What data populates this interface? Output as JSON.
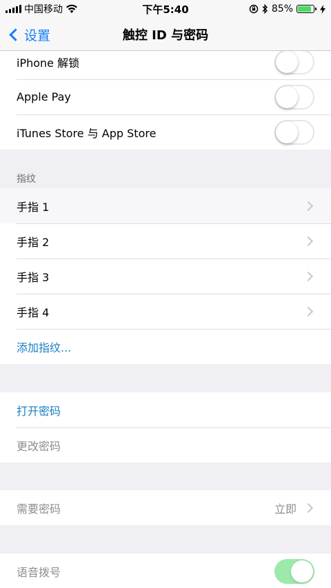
{
  "status": {
    "carrier": "中国移动",
    "time": "下午5:40",
    "battery_percent": "85%",
    "battery_level": 0.85,
    "icons": [
      "signal-icon",
      "wifi-icon",
      "orientation-lock-icon",
      "bluetooth-icon",
      "battery-icon",
      "charging-icon"
    ]
  },
  "nav": {
    "back_label": "设置",
    "title": "触控 ID 与密码"
  },
  "unlock_group": {
    "items": [
      {
        "label": "iPhone 解锁",
        "on": false
      },
      {
        "label": "Apple Pay",
        "on": false
      },
      {
        "label": "iTunes Store 与 App Store",
        "on": false
      }
    ]
  },
  "fingerprints": {
    "header": "指纹",
    "items": [
      "手指 1",
      "手指 2",
      "手指 3",
      "手指 4"
    ],
    "add_label": "添加指纹..."
  },
  "passcode": {
    "turn_on_label": "打开密码",
    "change_label": "更改密码"
  },
  "require": {
    "label": "需要密码",
    "value": "立即"
  },
  "voice_dial": {
    "label": "语音拨号",
    "on": true
  },
  "colors": {
    "link_blue": "#1a7fc1",
    "nav_blue": "#147efb",
    "toggle_on": "#4cd964"
  }
}
